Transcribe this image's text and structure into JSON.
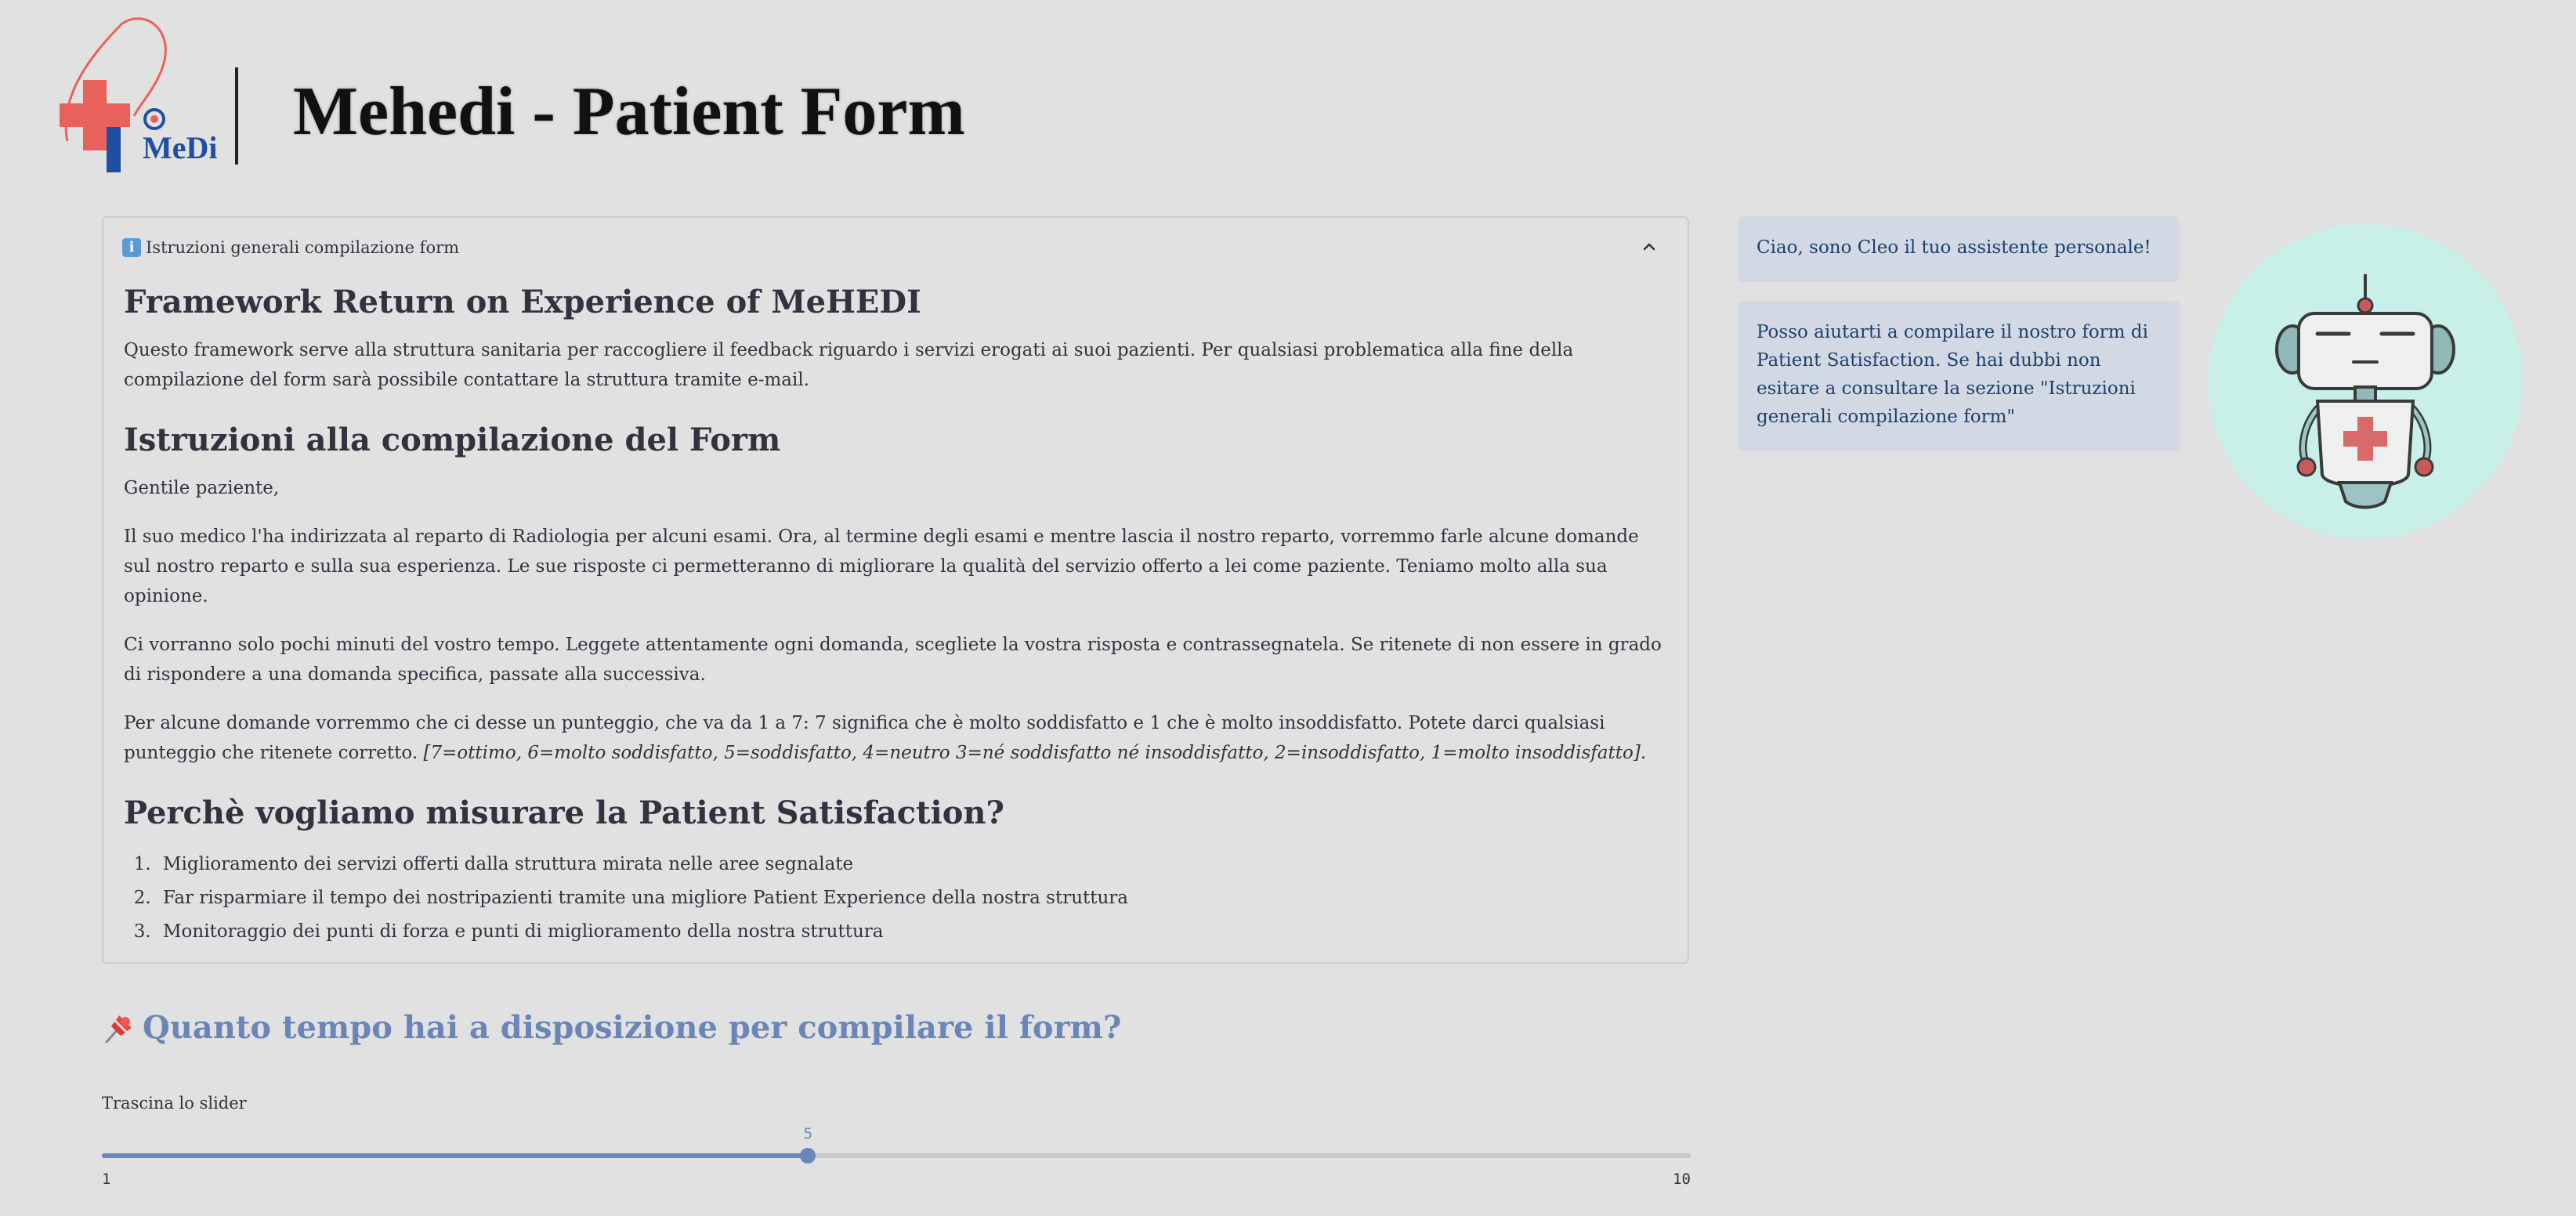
{
  "header": {
    "logo_text": "MeDi",
    "title": "Mehedi - Patient Form"
  },
  "expander": {
    "title": "Istruzioni generali compilazione form",
    "heading_1": "Framework Return on Experience of MeHEDI",
    "intro": "Questo framework serve alla struttura sanitaria per raccogliere il feedback riguardo i servizi erogati ai suoi pazienti. Per qualsiasi problematica alla fine della compilazione del form sarà possibile contattare la struttura tramite e-mail.",
    "heading_2": "Istruzioni alla compilazione del Form",
    "greeting": "Gentile paziente,",
    "paragraph_1": "Il suo medico l'ha indirizzata al reparto di Radiologia per alcuni esami. Ora, al termine degli esami e mentre lascia il nostro reparto, vorremmo farle alcune domande sul nostro reparto e sulla sua esperienza. Le sue risposte ci permetteranno di migliorare la qualità del servizio offerto a lei come paziente. Teniamo molto alla sua opinione.",
    "paragraph_2": "Ci vorranno solo pochi minuti del vostro tempo. Leggete attentamente ogni domanda, scegliete la vostra risposta e contrassegnatela. Se ritenete di non essere in grado di rispondere a una domanda specifica, passate alla successiva.",
    "paragraph_3": "Per alcune domande vorremmo che ci desse un punteggio, che va da 1 a 7: 7 significa che è molto soddisfatto e 1 che è molto insoddisfatto. Potete darci qualsiasi punteggio che ritenete corretto.",
    "paragraph_3_scale": "[7=ottimo, 6=molto soddisfatto, 5=soddisfatto, 4=neutro 3=né soddisfatto né insoddisfatto, 2=insoddisfatto, 1=molto insoddisfatto].",
    "heading_3": "Perchè vogliamo misurare la Patient Satisfaction?",
    "benefits": [
      "Miglioramento dei servizi offerti dalla struttura mirata nelle aree segnalate",
      "Far risparmiare il tempo dei nostripazienti tramite una migliore Patient Experience della nostra struttura",
      "Monitoraggio dei punti di forza e punti di miglioramento della nostra struttura"
    ]
  },
  "question": {
    "text": "Quanto tempo hai a disposizione per compilare il form?",
    "icon": "pushpin-icon"
  },
  "slider": {
    "label": "Trascina lo slider",
    "value": 5,
    "min": 1,
    "max": 10
  },
  "assistant": {
    "message_1": "Ciao, sono Cleo il tuo assistente personale!",
    "message_2": "Posso aiutarti a compilare il nostro form di Patient Satisfaction. Se hai dubbi non esitare a consultare la sezione \"Istruzioni generali compilazione form\""
  },
  "colors": {
    "background": "#e1e1e1",
    "accent": "#6a86b8",
    "bubble_bg": "#d2d9e4",
    "bubble_text": "#1d3f6e",
    "robot_circle": "#c8efe8",
    "logo_red": "#e8615a",
    "logo_blue": "#1f4fa3"
  }
}
